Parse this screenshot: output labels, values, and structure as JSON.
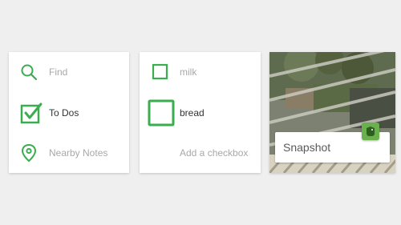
{
  "colors": {
    "accent": "#3aae4f",
    "muted_text": "#a8a8a8",
    "dark_text": "#333333"
  },
  "left_card": {
    "items": [
      {
        "label": "Find",
        "icon": "search-icon"
      },
      {
        "label": "To Dos",
        "icon": "checkbox-checked-icon"
      },
      {
        "label": "Nearby Notes",
        "icon": "location-pin-icon"
      }
    ]
  },
  "checklist_card": {
    "items": [
      {
        "label": "milk",
        "checked": false
      },
      {
        "label": "bread",
        "checked": false
      }
    ],
    "add_label": "Add a checkbox"
  },
  "snapshot_card": {
    "label": "Snapshot",
    "badge_icon": "evernote-elephant-icon"
  }
}
